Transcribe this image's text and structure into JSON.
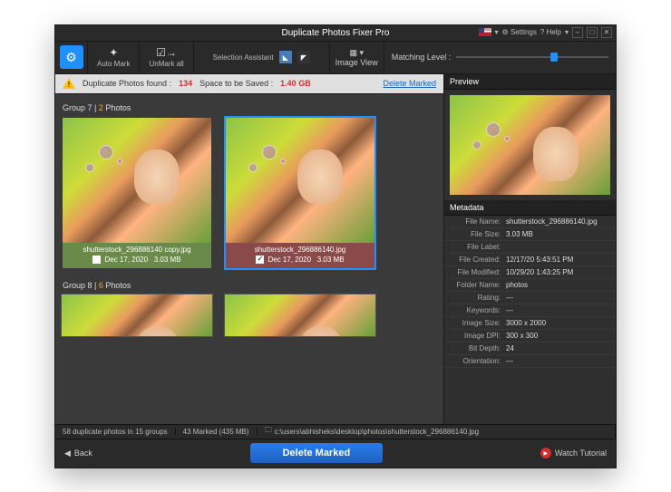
{
  "title": "Duplicate Photos Fixer Pro",
  "titlebar": {
    "settings": "Settings",
    "help": "? Help",
    "lang_dropdown": "▾"
  },
  "toolbar": {
    "automark": "Auto Mark",
    "unmarkall": "UnMark all",
    "selection": "Selection Assistant",
    "imageview": "Image View",
    "matching": "Matching Level :"
  },
  "info": {
    "dup_label": "Duplicate Photos found :",
    "dup_count": "134",
    "space_label": "Space to be Saved :",
    "space_val": "1.40 GB",
    "delete_marked": "Delete Marked"
  },
  "groups": [
    {
      "header_a": "Group 7 | ",
      "header_b": "2",
      "header_c": " Photos",
      "items": [
        {
          "name": "shutterstock_296886140 copy.jpg",
          "date": "Dec 17, 2020",
          "size": "3.03 MB",
          "checked": false,
          "sel": false,
          "bar": "cap-g"
        },
        {
          "name": "shutterstock_296886140.jpg",
          "date": "Dec 17, 2020",
          "size": "3.03 MB",
          "checked": true,
          "sel": true,
          "bar": "cap-r"
        }
      ]
    },
    {
      "header_a": "Group 8 | ",
      "header_b": "6",
      "header_c": " Photos"
    }
  ],
  "preview": {
    "header": "Preview"
  },
  "metadata": {
    "header": "Metadata",
    "rows": [
      {
        "k": "File Name:",
        "v": "shutterstock_296886140.jpg"
      },
      {
        "k": "File Size:",
        "v": "3.03 MB"
      },
      {
        "k": "File Label:",
        "v": ""
      },
      {
        "k": "File Created:",
        "v": "12/17/20 5:43:51 PM"
      },
      {
        "k": "File Modified:",
        "v": "10/29/20 1:43:25 PM"
      },
      {
        "k": "Folder Name:",
        "v": "photos"
      },
      {
        "k": "Rating:",
        "v": "---"
      },
      {
        "k": "Keywords:",
        "v": "---"
      },
      {
        "k": "Image Size:",
        "v": "3000 x 2000"
      },
      {
        "k": "Image DPI:",
        "v": "300 x 300"
      },
      {
        "k": "Bit Depth:",
        "v": "24"
      },
      {
        "k": "Orientation:",
        "v": "---"
      }
    ]
  },
  "status": {
    "summary": "58 duplicate photos in 15 groups",
    "marked": "43 Marked (435 MB)",
    "path": "c:\\users\\abhisheks\\desktop\\photos\\shutterstock_296886140.jpg"
  },
  "footer": {
    "back": "Back",
    "delete": "Delete Marked",
    "watch": "Watch Tutorial"
  }
}
